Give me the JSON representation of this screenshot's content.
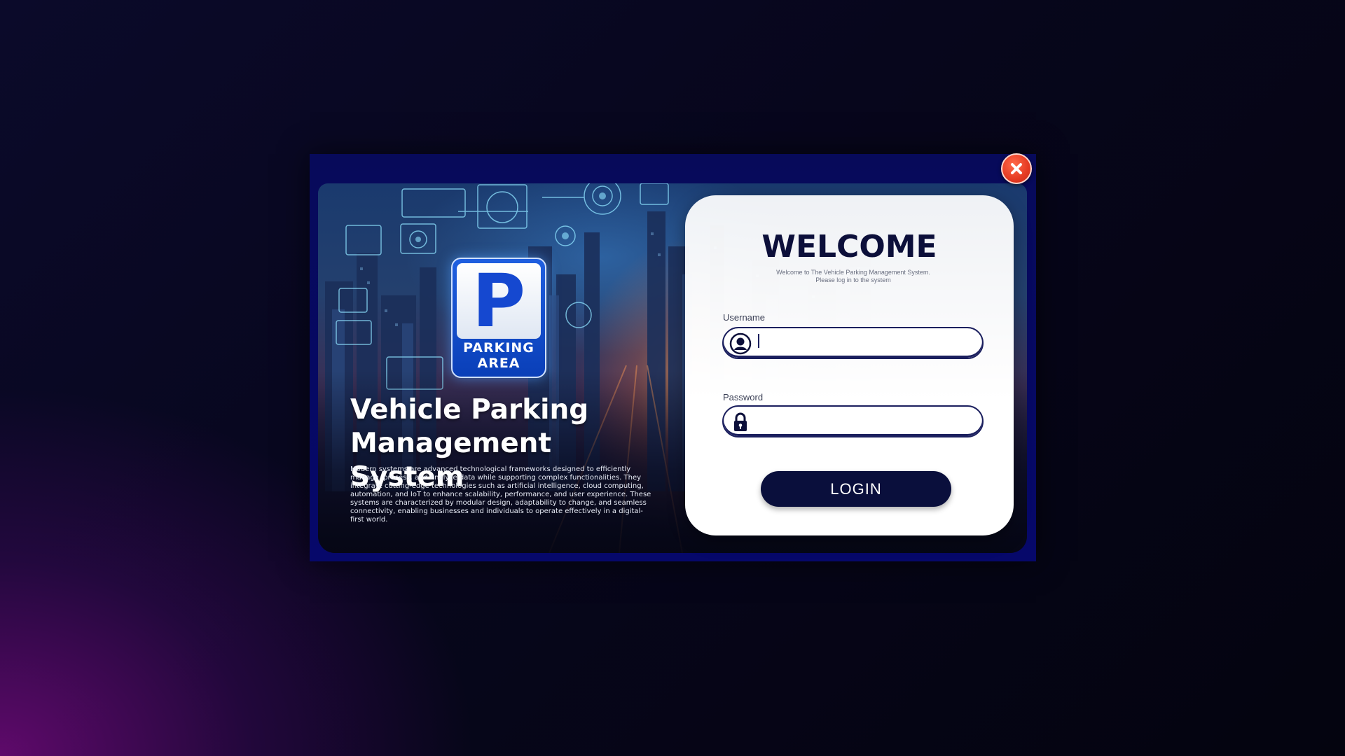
{
  "sign": {
    "letter": "P",
    "label": "PARKING\nAREA"
  },
  "hero": {
    "title": "Vehicle Parking\nManagement System",
    "description": "Modern systems are advanced technological frameworks designed to efficiently manage, process, and analyze data while supporting complex functionalities. They integrate cutting-edge technologies such as artificial intelligence, cloud computing, automation, and IoT to enhance scalability, performance, and user experience. These systems are characterized by modular design, adaptability to change, and seamless connectivity, enabling businesses and individuals to operate effectively in a digital-first world."
  },
  "login": {
    "welcome": "WELCOME",
    "subtitle": "Welcome to The Vehicle Parking Management System. Please log in to the system",
    "username_label": "Username",
    "username_value": "",
    "password_label": "Password",
    "password_value": "",
    "button_label": "LOGIN"
  },
  "colors": {
    "accent_navy": "#0a0f3c",
    "close_red": "#e53a22",
    "sign_blue": "#1548d0"
  },
  "icons": {
    "close": "close-icon",
    "username": "user-circle-icon",
    "password": "lock-icon"
  }
}
